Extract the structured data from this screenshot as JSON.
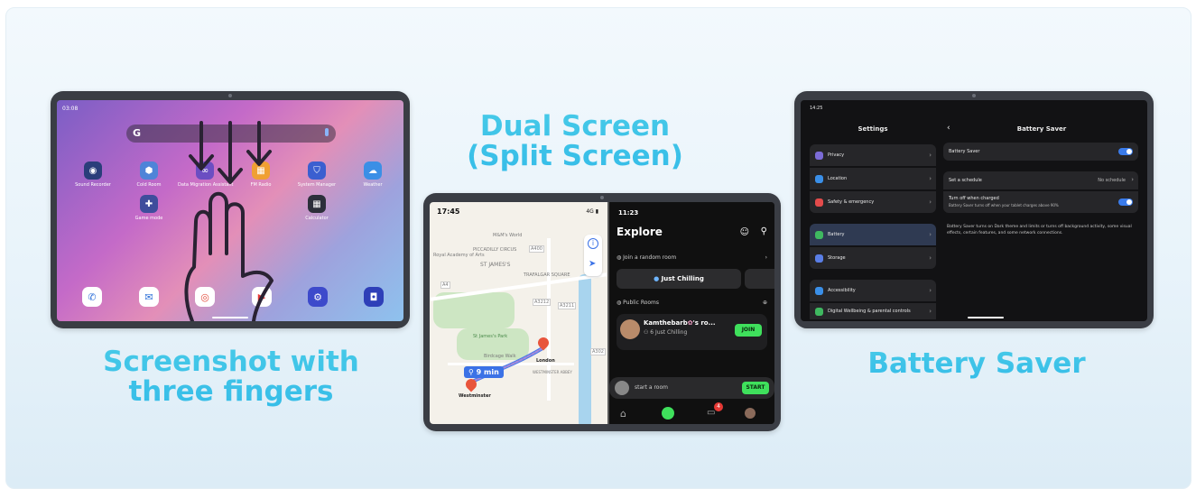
{
  "panels": {
    "left": {
      "caption_line1": "Screenshot with",
      "caption_line2": "three fingers",
      "status_time": "03:08",
      "search_logo": "G",
      "apps": [
        {
          "label": "Sound Recorder",
          "icon": "recorder-icon",
          "color": "#2a3e7a"
        },
        {
          "label": "Cold Room",
          "icon": "cold-room-icon",
          "color": "#4f84d8"
        },
        {
          "label": "Data Migration Assistant",
          "icon": "migration-icon",
          "color": "#6b4ec2"
        },
        {
          "label": "FM Radio",
          "icon": "radio-icon",
          "color": "#f0a033"
        },
        {
          "label": "System Manager",
          "icon": "shield-icon",
          "color": "#3b5fd0"
        },
        {
          "label": "Weather",
          "icon": "weather-icon",
          "color": "#3b8fe6"
        },
        {
          "label": "Game mode",
          "icon": "gamepad-icon",
          "color": "#3e4d9c"
        },
        {
          "label": "Calculator",
          "icon": "calculator-icon",
          "color": "#2c2f3a"
        }
      ]
    },
    "middle": {
      "caption_line1": "Dual Screen",
      "caption_line2": "(Split Screen)",
      "map_time": "17:45",
      "map_signal": "4G",
      "map_labels": [
        "M&M's World",
        "Royal Academy of Arts",
        "PICCADILLY CIRCUS",
        "ST JAMES'S",
        "TRAFALGAR SQUARE",
        "St James's Park",
        "Birdcage Walk",
        "Westminster",
        "London",
        "WESTMINSTER ABBEY"
      ],
      "road_labels": [
        "A400",
        "A4",
        "A3212",
        "A3211",
        "A302"
      ],
      "route_time": "9 min",
      "chat_time": "11:23",
      "explore_title": "Explore",
      "random_room": "Join a random room",
      "chip": "Just Chilling",
      "public_rooms": "Public Rooms",
      "room_name": "Kamthebarb",
      "room_name_suffix": "'s ro...",
      "room_count": "6",
      "room_topic": "Just Chilling",
      "join_label": "JOIN",
      "start_placeholder": "start a room",
      "start_label": "START",
      "badge_count": "4"
    },
    "right": {
      "caption": "Battery Saver",
      "status_time": "14:25",
      "settings_title": "Settings",
      "page_title": "Battery Saver",
      "menu": [
        {
          "label": "Privacy",
          "color": "#7b6bd6"
        },
        {
          "label": "Location",
          "color": "#3a8fe8"
        },
        {
          "label": "Safety & emergency",
          "color": "#e34b4b"
        },
        {
          "label": "Battery",
          "color": "#3fb860"
        },
        {
          "label": "Storage",
          "color": "#5a7ee6"
        },
        {
          "label": "Accessibility",
          "color": "#3a8fe8"
        },
        {
          "label": "Digital Wellbeing & parental controls",
          "color": "#3fb860"
        }
      ],
      "toggle_label": "Battery Saver",
      "schedule_label": "Set a schedule",
      "schedule_value": "No schedule",
      "turn_off_label": "Turn off when charged",
      "turn_off_desc": "Battery Saver turns off when your tablet charges above 90%",
      "info": "Battery Saver turns on Dark theme and limits or turns off background activity, some visual effects, certain features, and some network connections."
    }
  }
}
